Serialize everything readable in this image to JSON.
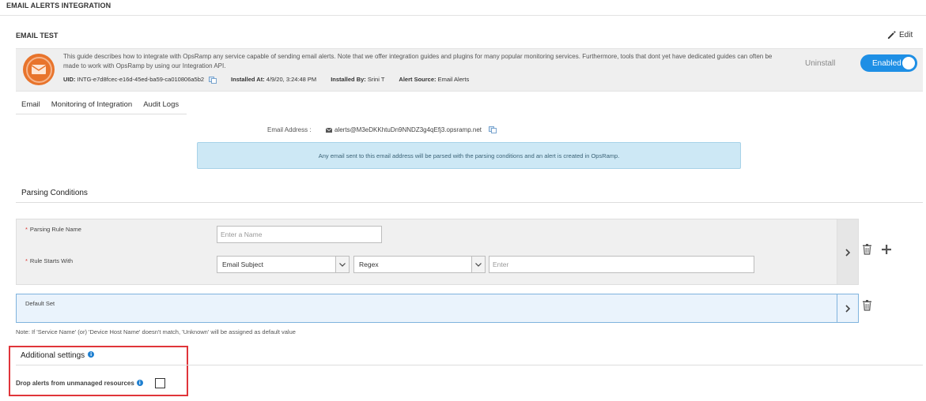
{
  "page": {
    "title": "EMAIL ALERTS INTEGRATION"
  },
  "integration": {
    "name": "EMAIL TEST",
    "edit_label": "Edit",
    "description": "This guide describes how to integrate with OpsRamp any service capable of sending email alerts. Note that we offer integration guides and plugins for many popular monitoring services. Furthermore, tools that dont yet have dedicated guides can often be made to work with OpsRamp by using our Integration API.",
    "uid_label": "UID:",
    "uid_value": "INTG-e7d8fcec-e16d-45ed-ba59-ca010806a5b2",
    "installed_at_label": "Installed At:",
    "installed_at_value": "4/9/20, 3:24:48 PM",
    "installed_by_label": "Installed By:",
    "installed_by_value": "Srini T",
    "alert_source_label": "Alert Source:",
    "alert_source_value": "Email Alerts",
    "uninstall_label": "Uninstall",
    "toggle_label": "Enabled"
  },
  "tabs": [
    {
      "label": "Email"
    },
    {
      "label": "Monitoring of Integration"
    },
    {
      "label": "Audit Logs"
    }
  ],
  "email": {
    "address_label": "Email Address :",
    "address_value": "alerts@M3eDKKhtuDn9NNDZ3g4qEfj3.opsramp.net",
    "info_text": "Any email sent to this email address will be parsed with the parsing conditions and an alert is created in OpsRamp."
  },
  "parsing": {
    "section_title": "Parsing Conditions",
    "rule_name_label": "Parsing Rule Name",
    "rule_name_placeholder": "Enter a Name",
    "starts_with_label": "Rule Starts With",
    "field_select_value": "Email Subject",
    "operator_select_value": "Regex",
    "value_placeholder": "Enter",
    "required_mark": "*",
    "default_set_label": "Default Set",
    "note": "Note: If 'Service Name' (or) 'Device Host Name' doesn't match, 'Unknown' will be assigned as default value"
  },
  "additional": {
    "title": "Additional settings",
    "info_mark": "i",
    "drop_label": "Drop alerts from unmanaged resources"
  },
  "colors": {
    "accent": "#1e8fe5",
    "highlight": "#e0353a",
    "logo": "#e8742c"
  }
}
